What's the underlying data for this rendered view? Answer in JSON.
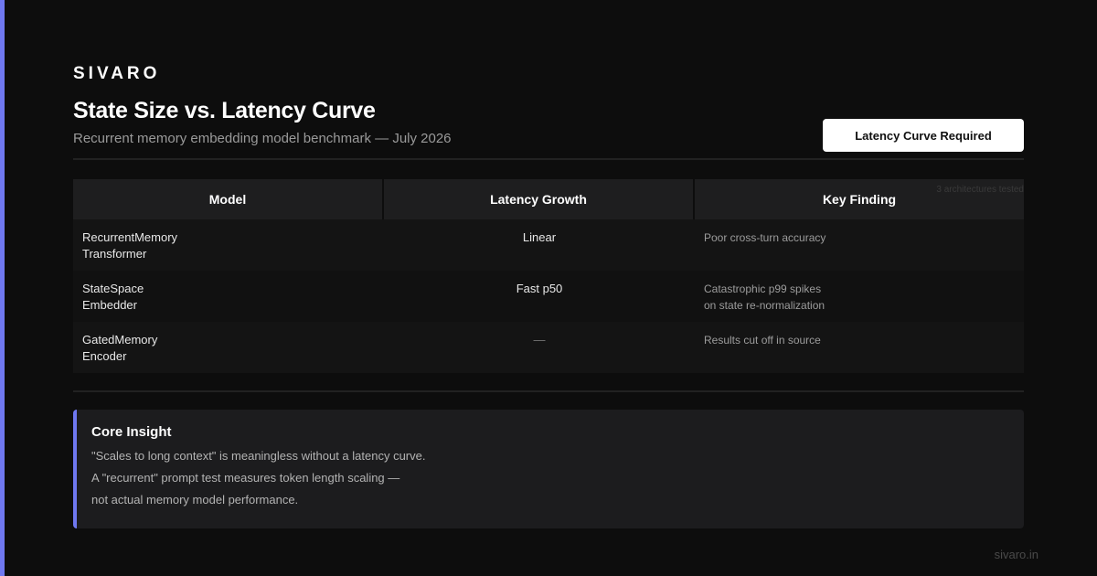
{
  "brand": "SIVARO",
  "header": {
    "title": "State Size vs. Latency Curve",
    "subtitle": "Recurrent memory embedding model benchmark — July 2026",
    "cta_label": "Latency Curve Required"
  },
  "table": {
    "columns": [
      "Model",
      "Latency Growth",
      "Key Finding"
    ],
    "tested_note": "3 architectures tested",
    "rows": [
      {
        "model_line1": "RecurrentMemory",
        "model_line2": "Transformer",
        "latency": "Linear",
        "finding_line1": "Poor cross-turn accuracy",
        "finding_line2": ""
      },
      {
        "model_line1": "StateSpace",
        "model_line2": "Embedder",
        "latency": "Fast p50",
        "finding_line1": "Catastrophic p99 spikes",
        "finding_line2": "on state re-normalization"
      },
      {
        "model_line1": "GatedMemory",
        "model_line2": "Encoder",
        "latency": "—",
        "finding_line1": "Results cut off in source",
        "finding_line2": ""
      }
    ]
  },
  "insight": {
    "title": "Core Insight",
    "lines": [
      "\"Scales to long context\" is meaningless without a latency curve.",
      "A \"recurrent\" prompt test measures token length scaling —",
      "not actual memory model performance."
    ]
  },
  "footer": {
    "url": "sivaro.in"
  },
  "colors": {
    "background": "#0d0d0d",
    "accent": "#6f78f0",
    "button_bg": "#ffffff"
  }
}
